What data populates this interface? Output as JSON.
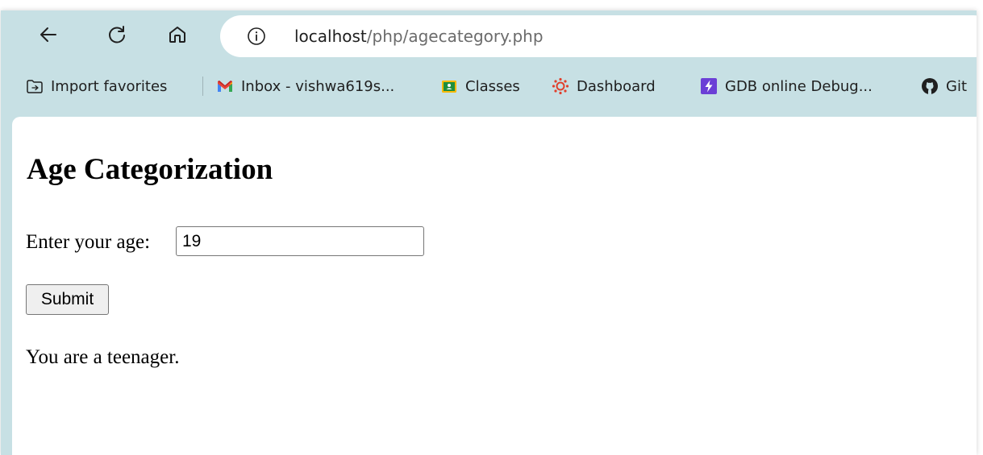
{
  "browser": {
    "address_bar": {
      "host": "localhost",
      "path": "/php/agecategory.php"
    },
    "nav_icons": [
      "back-arrow-icon",
      "refresh-icon",
      "home-icon",
      "info-icon"
    ],
    "favorites": [
      {
        "label": "Import favorites",
        "icon": "import-favorites-icon"
      },
      {
        "label": "Inbox - vishwa619s...",
        "icon": "gmail-icon"
      },
      {
        "label": "Classes",
        "icon": "google-classroom-icon"
      },
      {
        "label": "Dashboard",
        "icon": "canvas-dashboard-icon"
      },
      {
        "label": "GDB online Debug...",
        "icon": "gdb-bolt-icon"
      },
      {
        "label": "Git",
        "icon": "github-icon"
      }
    ],
    "colors": {
      "chrome_background": "#c7e0e4",
      "url_host": "#1f1f1f",
      "url_path": "#6b6b6b"
    }
  },
  "page": {
    "title": "Age Categorization",
    "age_label": "Enter your age:",
    "age_value": "19",
    "submit_label": "Submit",
    "result_text": "You are a teenager."
  }
}
